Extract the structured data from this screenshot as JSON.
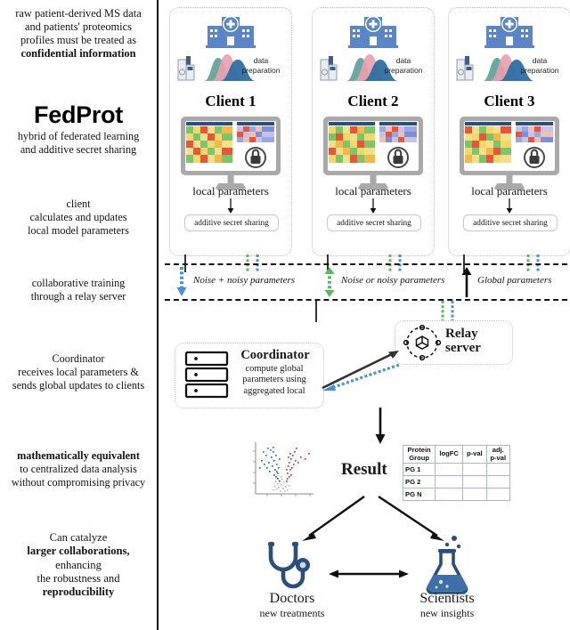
{
  "left_notes": [
    {
      "lines": [
        {
          "text": "raw patient-derived MS data",
          "bold": false
        },
        {
          "text": "and patients' proteomics",
          "bold": false
        },
        {
          "text": "profiles must be treated as",
          "bold": false
        },
        {
          "text": "confidential information",
          "bold": true
        }
      ]
    },
    {
      "lines": [
        {
          "text": "hybrid of federated learning",
          "bold": false
        },
        {
          "text": "and additive secret sharing",
          "bold": false
        }
      ]
    },
    {
      "lines": [
        {
          "text": "client",
          "bold": false
        },
        {
          "text": "calculates and updates",
          "bold": false
        },
        {
          "text": "local model parameters",
          "bold": false
        }
      ]
    },
    {
      "lines": [
        {
          "text": "collaborative training",
          "bold": false
        },
        {
          "text": "through a relay server",
          "bold": false
        }
      ]
    },
    {
      "lines": [
        {
          "text": "Coordinator",
          "bold": false
        },
        {
          "text": "receives local parameters &",
          "bold": false
        },
        {
          "text": "sends global updates to clients",
          "bold": false
        }
      ]
    },
    {
      "lines": [
        {
          "text": "mathematically equivalent",
          "bold": true
        },
        {
          "text": "to centralized data analysis",
          "bold": false
        },
        {
          "text": "without compromising privacy",
          "bold": false
        }
      ]
    },
    {
      "lines": [
        {
          "text": "Can catalyze",
          "bold": false
        },
        {
          "text": "larger collaborations,",
          "bold": true
        },
        {
          "text": "enhancing",
          "bold": false
        },
        {
          "text": "the robustness and",
          "bold": false
        },
        {
          "text": "reproducibility",
          "bold": true
        }
      ]
    }
  ],
  "brand": {
    "name": "FedProt"
  },
  "clients": [
    {
      "name": "Client 1",
      "data_prep": "data\npreparation",
      "local_params": "local parameters",
      "secret_sharing": "additive secret sharing"
    },
    {
      "name": "Client 2",
      "data_prep": "data\npreparation",
      "local_params": "local parameters",
      "secret_sharing": "additive secret sharing"
    },
    {
      "name": "Client 3",
      "data_prep": "data\npreparation",
      "local_params": "local parameters",
      "secret_sharing": "additive secret sharing"
    }
  ],
  "flow_legend": [
    {
      "label": "Noise + noisy parameters",
      "arrow": "down",
      "color": "#4a90d9"
    },
    {
      "label": "Noise or noisy parameters",
      "arrow": "updown",
      "color": "#5cb85c"
    },
    {
      "label": "Global parameters",
      "arrow": "up",
      "color": "#111111"
    }
  ],
  "coordinator": {
    "title": "Coordinator",
    "subtitle_lines": [
      "compute global",
      "parameters using",
      "aggregated local"
    ]
  },
  "relay": {
    "title_lines": [
      "Relay",
      "server"
    ]
  },
  "result": {
    "label": "Result"
  },
  "protein_table": {
    "headers": [
      "Protein Group",
      "logFC",
      "p-val",
      "adj. p-val"
    ],
    "header_lines": [
      [
        "Protein",
        "Group"
      ],
      [
        "logFC"
      ],
      [
        "p-val"
      ],
      [
        "adj.",
        "p-val"
      ]
    ],
    "rows": [
      [
        "PG 1",
        "",
        "",
        ""
      ],
      [
        "PG 2",
        "",
        "",
        ""
      ],
      [
        "PG N",
        "",
        "",
        ""
      ]
    ]
  },
  "outcomes": [
    {
      "title": "Doctors",
      "subtitle": "new treatments",
      "icon": "stethoscope-icon"
    },
    {
      "title": "Scientists",
      "subtitle": "new insights",
      "icon": "flask-icon"
    }
  ],
  "colors": {
    "hospital_blue": "#5b85c4",
    "curve_teal": "#6aa9a0",
    "curve_pink": "#e8a0ae",
    "curve_blue": "#2e6fa3",
    "noise_blue": "#4a90d9",
    "noise_green": "#5cb85c",
    "dark_navy": "#2b4f7d",
    "volcano_red": "#d33a2c",
    "volcano_blue": "#2f6fb5",
    "volcano_gray": "#b9b9b9"
  }
}
